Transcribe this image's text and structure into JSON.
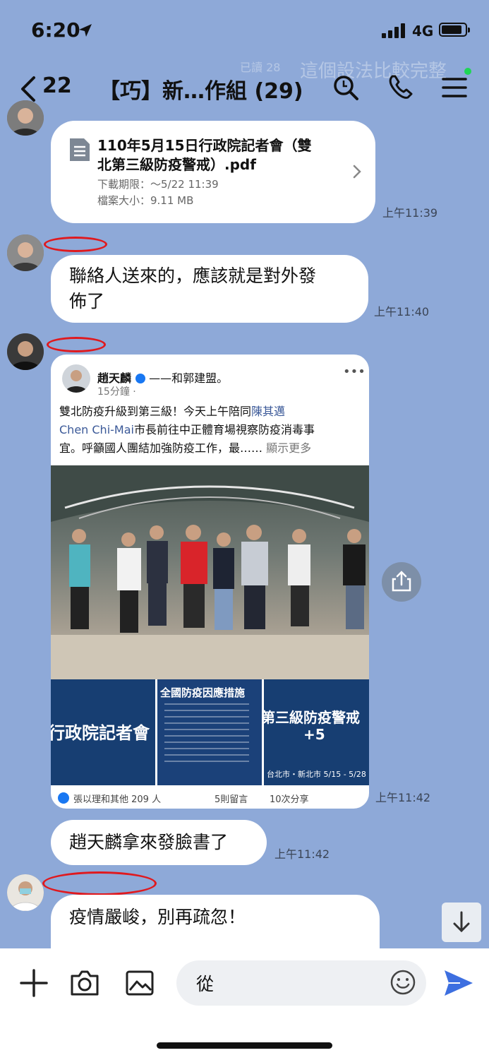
{
  "status": {
    "time": "6:20",
    "network": "4G"
  },
  "header": {
    "back_count": "22",
    "title": "【巧】新…作組 (29)",
    "ghost_text_1": "這個設法比較完整",
    "ghost_text_2": "已讀 28"
  },
  "messages": [
    {
      "type": "file",
      "file_name": "110年5月15日行政院記者會（雙北第三級防疫警戒）.pdf",
      "file_name_line1": "110年5月15日行政院記者會（雙",
      "file_name_line2": "北第三級防疫警戒）.pdf",
      "expiry": "下載期限：～5/22 11:39",
      "size": "檔案大小：9.11 MB",
      "time": "上午11:39"
    },
    {
      "type": "text",
      "line1": "聯絡人送來的，應該就是對外發",
      "line2": "佈了",
      "time": "上午11:40"
    },
    {
      "type": "facebook-post",
      "author": "趙天麟",
      "with_text": "——和郭建盟。",
      "posted": "15分鐘 · ",
      "text_line1_a": "雙北防疫升級到第三級！今天上午陪同",
      "text_line1_b": "陳其邁",
      "text_line2_a": "Chen Chi-Mai",
      "text_line2_b": "市長前往中正體育場視察防疫消毒事",
      "text_line3_a": "宜。呼籲國人團結加強防疫工作，最……",
      "text_line3_b": "顯示更多",
      "panel1": "行政院記者會",
      "panel2": "全國防疫因應措施",
      "panel3a": "第三級防疫警戒",
      "panel3b": "+5",
      "panel3c": "台北市・新北市   5/15 - 5/28",
      "reactions": "張以理和其他 209 人",
      "comments": "5則留言",
      "shares": "10次分享",
      "time": "上午11:42"
    },
    {
      "type": "text",
      "line1": "趙天麟拿來發臉書了",
      "time": "上午11:42"
    },
    {
      "type": "text",
      "line1": "疫情嚴峻，別再疏忽！"
    }
  ],
  "composer": {
    "text": "從"
  },
  "colors": {
    "background": "#8ea9d8",
    "bubble": "#ffffff",
    "send": "#3d6fe0",
    "annotation": "#e0191e"
  }
}
